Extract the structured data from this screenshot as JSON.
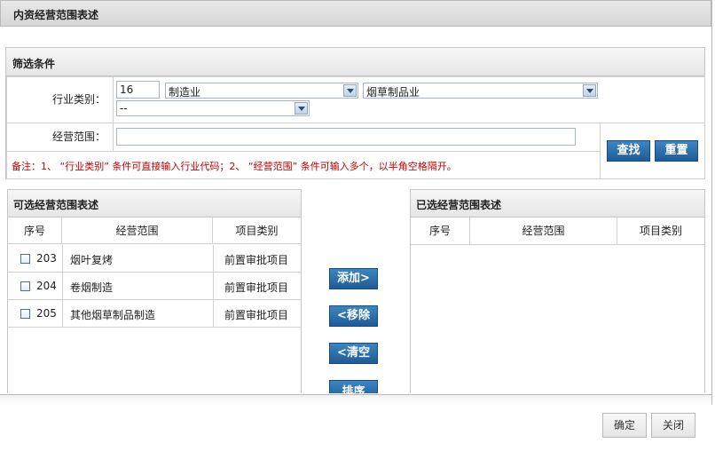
{
  "page": {
    "title": "内资经营范围表述"
  },
  "filter": {
    "heading": "筛选条件",
    "industry_label": "行业类别：",
    "industry_code": "16",
    "industry_level1": "制造业",
    "industry_level2": "烟草制品业",
    "industry_level3": "--",
    "scope_label": "经营范围：",
    "scope_value": "",
    "search_button": "查找",
    "reset_button": "重置",
    "note": "备注：1、 “行业类别” 条件可直接输入行业代码；2、 “经营范围” 条件可输入多个，以半角空格隔开。"
  },
  "available": {
    "heading": "可选经营范围表述",
    "columns": [
      "序号",
      "经营范围",
      "项目类别"
    ],
    "rows": [
      {
        "no": "203",
        "scope": "烟叶复烤",
        "category": "前置审批项目"
      },
      {
        "no": "204",
        "scope": "卷烟制造",
        "category": "前置审批项目"
      },
      {
        "no": "205",
        "scope": "其他烟草制品制造",
        "category": "前置审批项目"
      }
    ]
  },
  "actions": {
    "add": "添加>",
    "remove": "<移除",
    "clear": "<清空",
    "sort": "排序"
  },
  "selected": {
    "heading": "已选经营范围表述",
    "columns": [
      "序号",
      "经营范围",
      "项目类别"
    ]
  },
  "footer": {
    "confirm": "确定",
    "close": "关闭"
  }
}
